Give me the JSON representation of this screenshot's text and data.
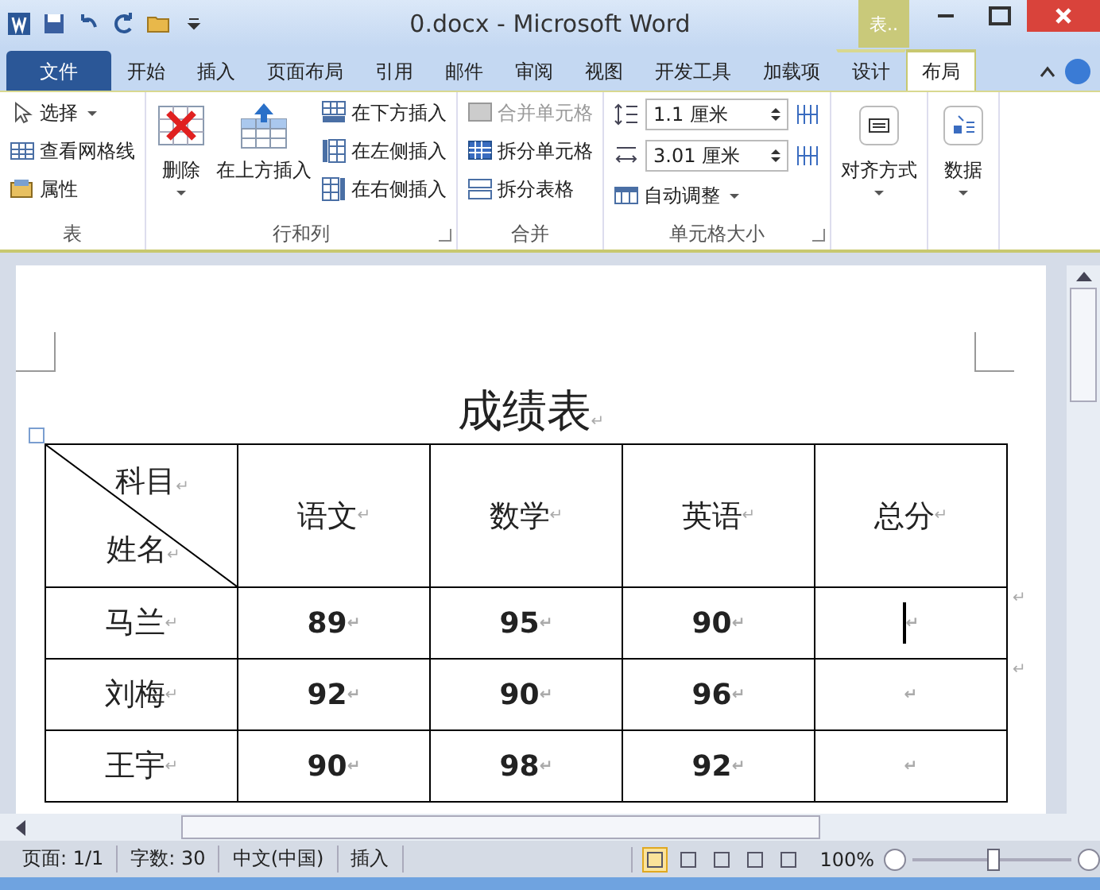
{
  "window": {
    "title": "0.docx - Microsoft Word",
    "context_tab": "表.."
  },
  "tabs": [
    {
      "label": "文件",
      "kind": "file",
      "selected": false
    },
    {
      "label": "开始",
      "kind": "tab",
      "selected": false
    },
    {
      "label": "插入",
      "kind": "tab",
      "selected": false
    },
    {
      "label": "页面布局",
      "kind": "tab",
      "selected": false
    },
    {
      "label": "引用",
      "kind": "tab",
      "selected": false
    },
    {
      "label": "邮件",
      "kind": "tab",
      "selected": false
    },
    {
      "label": "审阅",
      "kind": "tab",
      "selected": false
    },
    {
      "label": "视图",
      "kind": "tab",
      "selected": false
    },
    {
      "label": "开发工具",
      "kind": "tab",
      "selected": false
    },
    {
      "label": "加载项",
      "kind": "tab",
      "selected": false
    },
    {
      "label": "设计",
      "kind": "context",
      "selected": false
    },
    {
      "label": "布局",
      "kind": "context",
      "selected": true
    }
  ],
  "ribbon": [
    {
      "label": "表",
      "items": [
        {
          "kind": "small",
          "label": "选择",
          "dropdown": true
        },
        {
          "kind": "small",
          "label": "查看网格线"
        },
        {
          "kind": "small",
          "label": "属性"
        }
      ]
    },
    {
      "label": "行和列",
      "launcher": true,
      "items": [
        {
          "kind": "large",
          "label": "删除",
          "dropdown": true
        },
        {
          "kind": "large",
          "label": "在上方插入"
        },
        {
          "kind": "small",
          "label": "在下方插入"
        },
        {
          "kind": "small",
          "label": "在左侧插入"
        },
        {
          "kind": "small",
          "label": "在右侧插入"
        }
      ]
    },
    {
      "label": "合并",
      "items": [
        {
          "kind": "small",
          "label": "合并单元格",
          "disabled": true
        },
        {
          "kind": "small",
          "label": "拆分单元格"
        },
        {
          "kind": "small",
          "label": "拆分表格"
        }
      ]
    },
    {
      "label": "单元格大小",
      "launcher": true,
      "items": [
        {
          "kind": "spinner",
          "value": "1.1 厘米"
        },
        {
          "kind": "spinner",
          "value": "3.01 厘米"
        },
        {
          "kind": "small",
          "label": "自动调整",
          "dropdown": true
        }
      ]
    },
    {
      "items": [
        {
          "kind": "large",
          "label": "对齐方式",
          "dropdown": true
        }
      ]
    },
    {
      "items": [
        {
          "kind": "large",
          "label": "数据",
          "dropdown": true
        }
      ]
    }
  ],
  "document": {
    "title": {
      "text": "成绩表",
      "mark": "↵"
    },
    "header": {
      "top": {
        "text": "科目",
        "mark": "↵"
      },
      "bottom": {
        "text": "姓名",
        "mark": "↵"
      },
      "columns": [
        {
          "text": "语文",
          "mark": "↵"
        },
        {
          "text": "数学",
          "mark": "↵"
        },
        {
          "text": "英语",
          "mark": "↵"
        },
        {
          "text": "总分",
          "mark": "↵"
        }
      ]
    },
    "rows": [
      {
        "name": {
          "text": "马兰",
          "mark": "↵"
        },
        "cells": [
          {
            "text": "89",
            "mark": "↵"
          },
          {
            "text": "95",
            "mark": "↵"
          },
          {
            "text": "90",
            "mark": "↵"
          },
          {
            "mark": "↵",
            "cursor": true
          }
        ],
        "end_mark": "↵"
      },
      {
        "name": {
          "text": "刘梅",
          "mark": "↵"
        },
        "cells": [
          {
            "text": "92",
            "mark": "↵"
          },
          {
            "text": "90",
            "mark": "↵"
          },
          {
            "text": "96",
            "mark": "↵"
          },
          {
            "mark": "↵"
          }
        ],
        "end_mark": "↵"
      },
      {
        "name": {
          "text": "王宇",
          "mark": "↵"
        },
        "cells": [
          {
            "text": "90",
            "mark": "↵"
          },
          {
            "text": "98",
            "mark": "↵"
          },
          {
            "text": "92",
            "mark": "↵"
          },
          {
            "mark": "↵"
          }
        ]
      }
    ]
  },
  "status_bar": {
    "items": [
      "页面: 1/1",
      "字数: 30",
      "中文(中国)",
      "插入"
    ],
    "views": [
      {
        "selected": true
      },
      {
        "selected": false
      },
      {
        "selected": false
      },
      {
        "selected": false
      },
      {
        "selected": false
      }
    ],
    "zoom": "100%",
    "zoom_level": {
      "level": 0.5
    }
  }
}
